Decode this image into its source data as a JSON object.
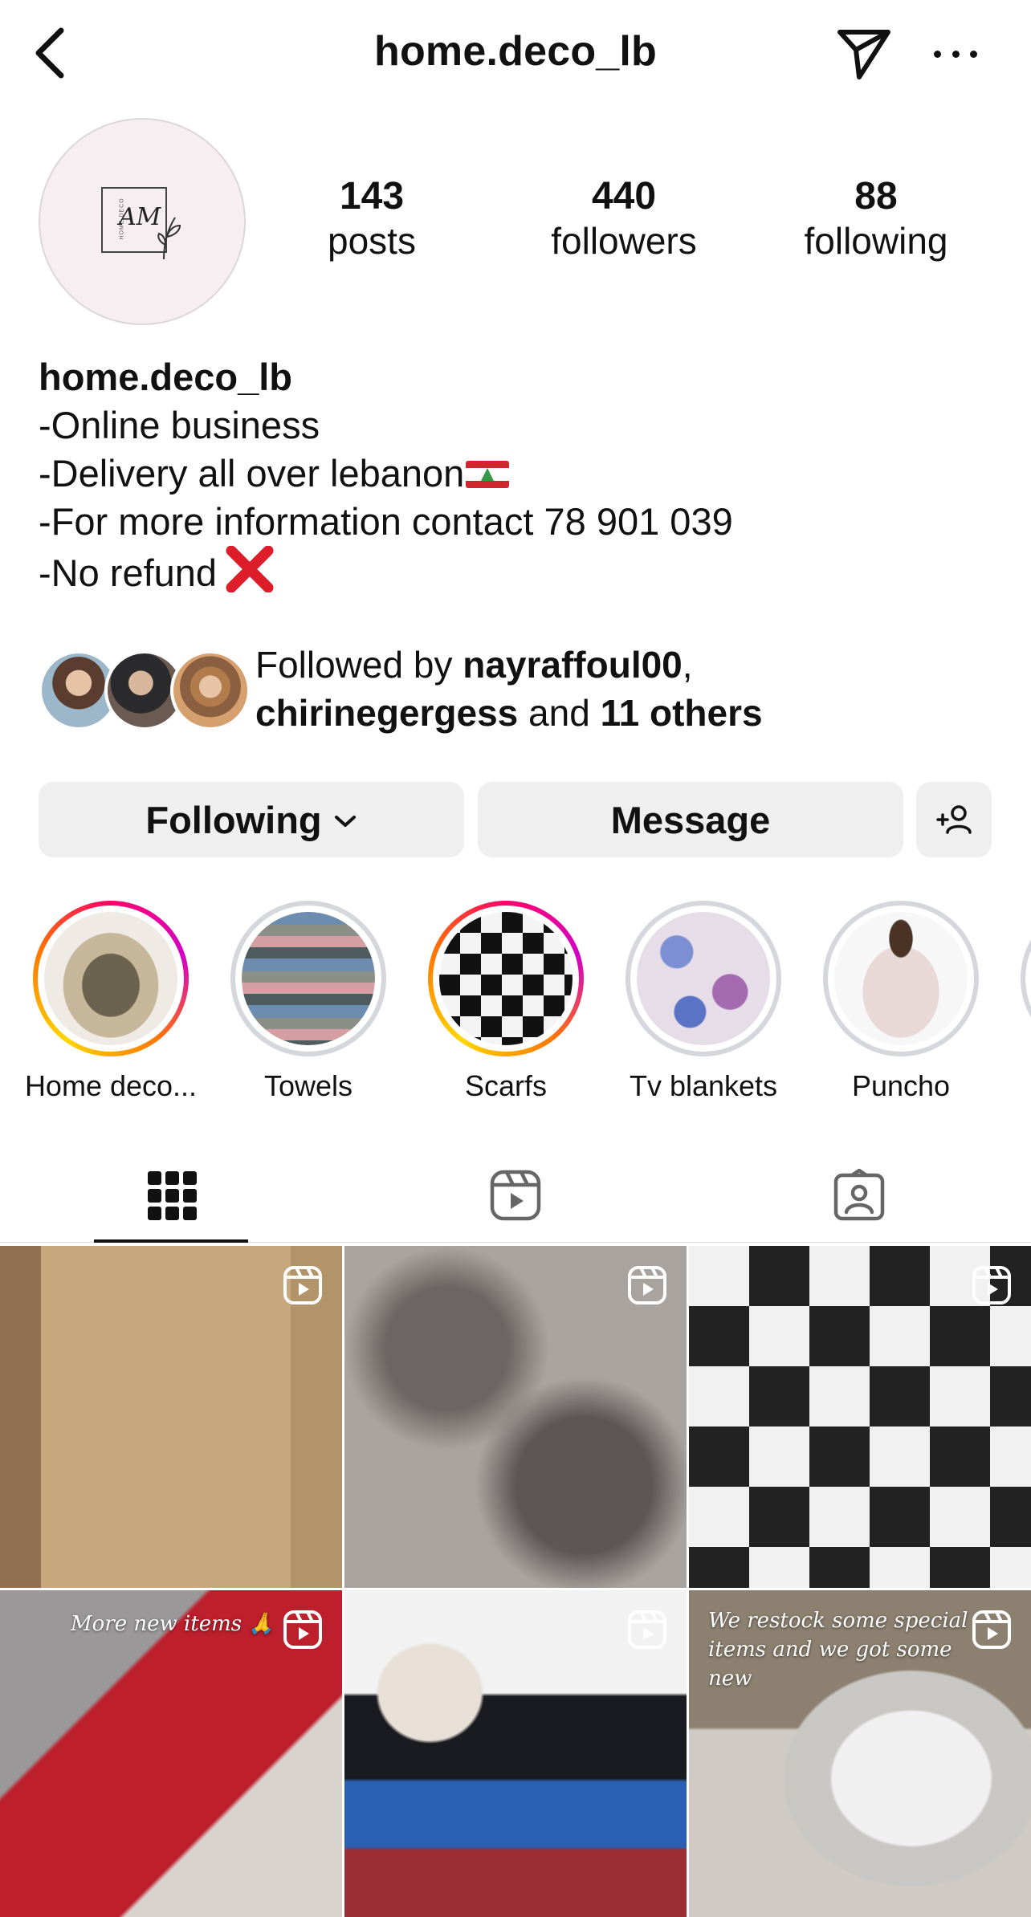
{
  "header": {
    "title": "home.deco_lb"
  },
  "profile": {
    "avatar_logo_text": "AM",
    "avatar_logo_side": "HOME DECO",
    "stats": {
      "posts_count": "143",
      "posts_label": "posts",
      "followers_count": "440",
      "followers_label": "followers",
      "following_count": "88",
      "following_label": "following"
    }
  },
  "bio": {
    "name": "home.deco_lb",
    "line1": "-Online business",
    "line2": "-Delivery all over lebanon",
    "line3": "-For more information contact 78 901 039",
    "line4": "-No refund"
  },
  "followed_by": {
    "prefix": "Followed by ",
    "user1": "nayraffoul00",
    "separator": ",",
    "user2": "chirinegergess",
    "middle": " and ",
    "others": "11 others"
  },
  "actions": {
    "following_label": "Following",
    "message_label": "Message"
  },
  "highlights": [
    {
      "label": "Home deco..."
    },
    {
      "label": "Towels"
    },
    {
      "label": "Scarfs"
    },
    {
      "label": "Tv blankets"
    },
    {
      "label": "Puncho"
    }
  ],
  "posts": [
    {
      "caption": ""
    },
    {
      "caption": ""
    },
    {
      "caption": ""
    },
    {
      "caption": "More new items 🙏"
    },
    {
      "caption": ""
    },
    {
      "caption": "We restock some special items and we got some new"
    }
  ],
  "colors": {
    "text": "#111111",
    "button_bg": "#efeff0",
    "no_refund_x": "#dd1e2a",
    "story_ring": "#ff0169"
  },
  "icons": [
    "back-icon",
    "send-icon",
    "more-icon",
    "chevron-down-icon",
    "add-user-icon",
    "grid-icon",
    "reels-icon",
    "tagged-icon",
    "reel-badge-icon"
  ]
}
